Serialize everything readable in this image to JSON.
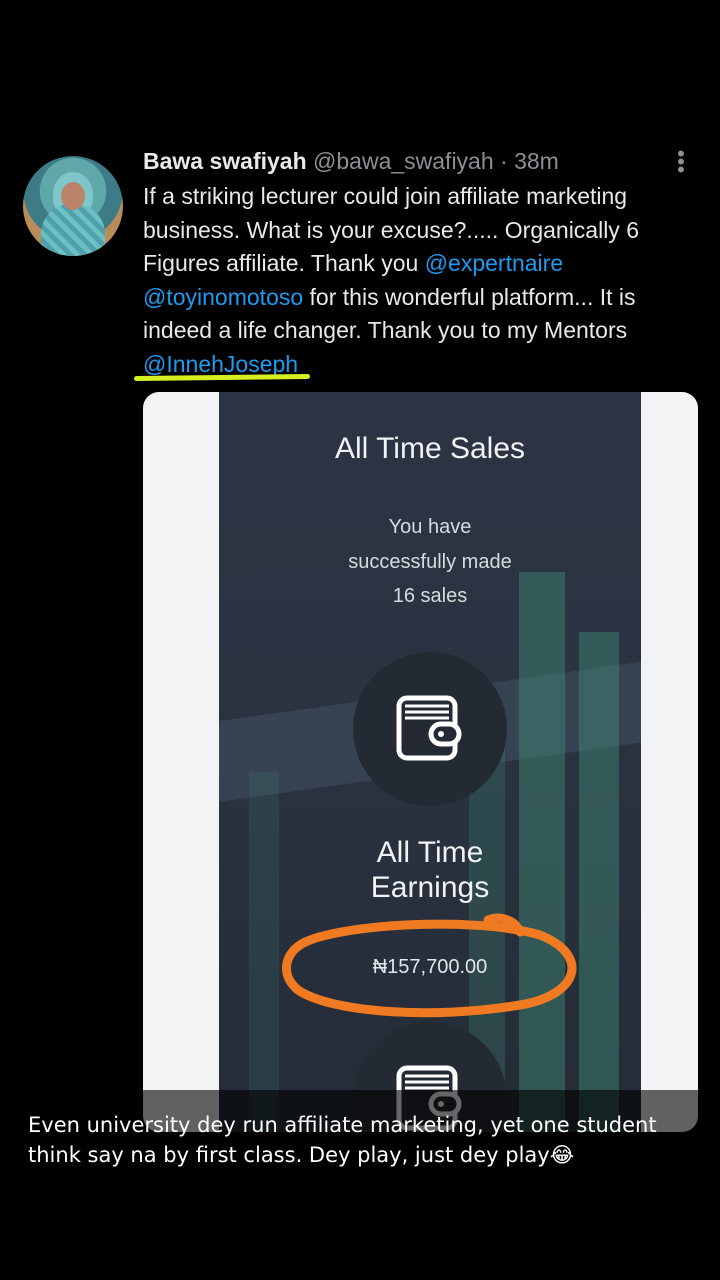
{
  "tweet": {
    "display_name": "Bawa swafiyah",
    "handle": "@bawa_swafiyah",
    "separator": "·",
    "time": "38m",
    "text_1": "If a striking lecturer could join affiliate marketing business. What is your excuse?..... Organically 6 Figures affiliate. Thank you ",
    "mention_1": "@expertnaire",
    "text_2": " ",
    "mention_2": "@toyinomotoso",
    "text_3": " for this wonderful platform... It is indeed a life changer. Thank you to my Mentors ",
    "mention_3": "@InnehJoseph"
  },
  "media": {
    "heading": "All Time Sales",
    "sales_line_1": "You have",
    "sales_line_2": "successfully made",
    "sales_line_3": "16 sales",
    "earnings_line_1": "All Time",
    "earnings_line_2": "Earnings",
    "earnings_value": "₦157,700.00"
  },
  "caption": {
    "text": "Even university dey run affiliate marketing, yet one student think say na by first class. Dey play, just dey play😂"
  },
  "icons": {
    "avatar": "profile-photo",
    "more": "more-vertical-icon",
    "wallet": "wallet-icon"
  },
  "colors": {
    "mention": "#1d9bf0",
    "highlight_underline": "#d6ef1e",
    "annotation_circle": "#f07a22"
  }
}
